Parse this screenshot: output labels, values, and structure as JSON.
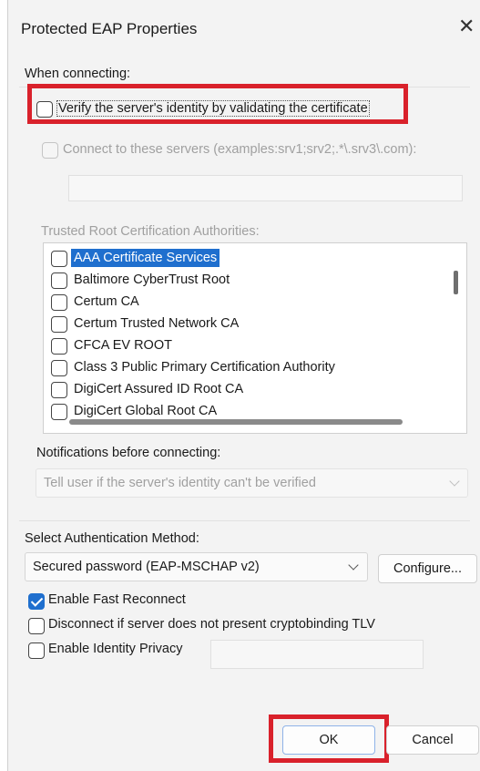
{
  "window": {
    "title": "Protected EAP Properties",
    "close_glyph": "✕"
  },
  "connecting": {
    "heading": "When connecting:",
    "verify_checkbox": {
      "label": "Verify the server's identity by validating the certificate",
      "checked": false,
      "highlighted": true
    },
    "connect_servers": {
      "label": "Connect to these servers (examples:srv1;srv2;.*\\.srv3\\.com):",
      "checked": false,
      "enabled": false
    },
    "servers_value": "",
    "trusted_root_label": "Trusted Root Certification Authorities:",
    "trusted_roots": [
      {
        "label": "AAA Certificate Services",
        "checked": false,
        "selected": true
      },
      {
        "label": "Baltimore CyberTrust Root",
        "checked": false,
        "selected": false
      },
      {
        "label": "Certum CA",
        "checked": false,
        "selected": false
      },
      {
        "label": "Certum Trusted Network CA",
        "checked": false,
        "selected": false
      },
      {
        "label": "CFCA EV ROOT",
        "checked": false,
        "selected": false
      },
      {
        "label": "Class 3 Public Primary Certification Authority",
        "checked": false,
        "selected": false
      },
      {
        "label": "DigiCert Assured ID Root CA",
        "checked": false,
        "selected": false
      },
      {
        "label": "DigiCert Global Root CA",
        "checked": false,
        "selected": false
      }
    ],
    "notifications_label": "Notifications before connecting:",
    "notifications_value": "Tell user if the server's identity can't be verified"
  },
  "auth": {
    "label": "Select Authentication Method:",
    "method_value": "Secured password (EAP-MSCHAP v2)",
    "configure_label": "Configure...",
    "enable_fast_reconnect": {
      "label": "Enable Fast Reconnect",
      "checked": true
    },
    "disconnect_cryptobinding": {
      "label": "Disconnect if server does not present cryptobinding TLV",
      "checked": false
    },
    "enable_identity_privacy": {
      "label": "Enable Identity Privacy",
      "checked": false
    },
    "identity_value": ""
  },
  "buttons": {
    "ok_label": "OK",
    "cancel_label": "Cancel"
  },
  "colors": {
    "highlight_box": "#d9212b",
    "accent": "#1f6fce"
  }
}
